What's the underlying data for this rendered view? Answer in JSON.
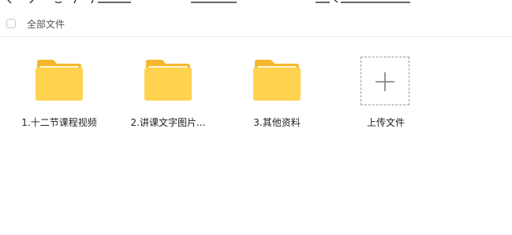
{
  "select_bar": {
    "label": "全部文件"
  },
  "files": [
    {
      "name": "1.十二节课程视频",
      "type": "folder"
    },
    {
      "name": "2.讲课文字图片...",
      "type": "folder"
    },
    {
      "name": "3.其他资料",
      "type": "folder"
    }
  ],
  "upload": {
    "label": "上传文件",
    "icon": "plus-icon"
  },
  "colors": {
    "folder_front": "#ffd24f",
    "folder_back": "#f5b72b",
    "folder_paper": "#fff5d6"
  }
}
